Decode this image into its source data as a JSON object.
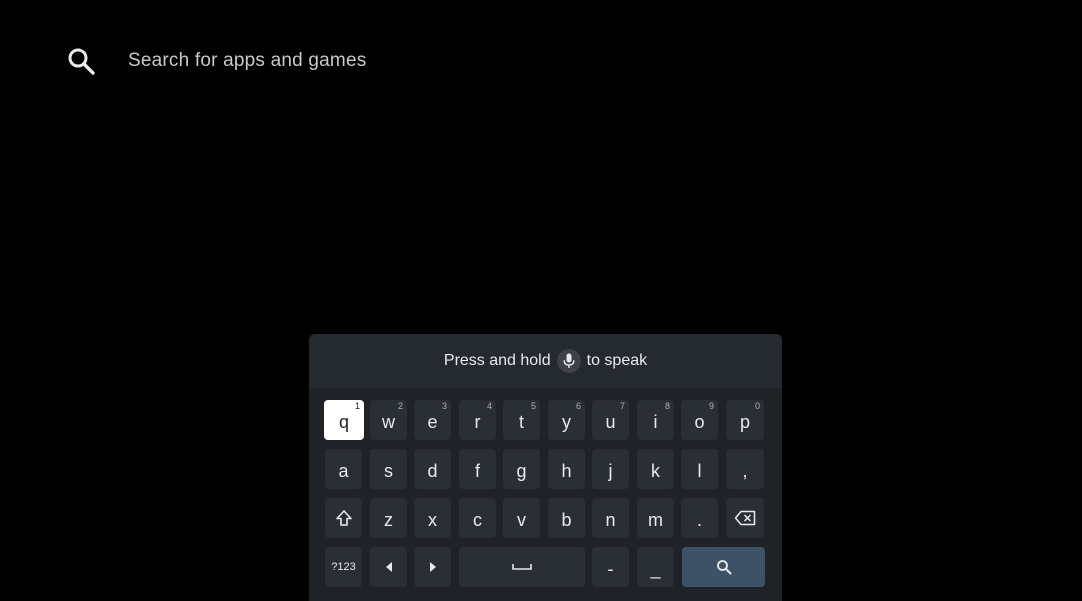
{
  "search": {
    "icon": "search-icon",
    "placeholder": "Search for apps and games"
  },
  "keyboard": {
    "hint_before": "Press and hold",
    "hint_icon": "mic-icon",
    "hint_after": "to speak",
    "row1": [
      {
        "label": "q",
        "alt": "1"
      },
      {
        "label": "w",
        "alt": "2"
      },
      {
        "label": "e",
        "alt": "3"
      },
      {
        "label": "r",
        "alt": "4"
      },
      {
        "label": "t",
        "alt": "5"
      },
      {
        "label": "y",
        "alt": "6"
      },
      {
        "label": "u",
        "alt": "7"
      },
      {
        "label": "i",
        "alt": "8"
      },
      {
        "label": "o",
        "alt": "9"
      },
      {
        "label": "p",
        "alt": "0"
      }
    ],
    "row2": [
      "a",
      "s",
      "d",
      "f",
      "g",
      "h",
      "j",
      "k",
      "l",
      ","
    ],
    "row3": {
      "shift_icon": "shift-icon",
      "letters": [
        "z",
        "x",
        "c",
        "v",
        "b",
        "n",
        "m",
        "."
      ],
      "backspace_icon": "backspace-icon"
    },
    "row4": {
      "symbols_label": "?123",
      "left_icon": "arrow-left-icon",
      "right_icon": "arrow-right-icon",
      "space_icon": "space-icon",
      "dash_label": "-",
      "underscore_label": "_",
      "search_icon": "search-icon"
    },
    "focused_key": "q",
    "colors": {
      "key_bg": "#2a2f35",
      "focused_bg": "#ffffff",
      "search_key_bg": "#3d5266",
      "panel_bg": "#1f2328",
      "header_bg": "#252a30"
    }
  }
}
